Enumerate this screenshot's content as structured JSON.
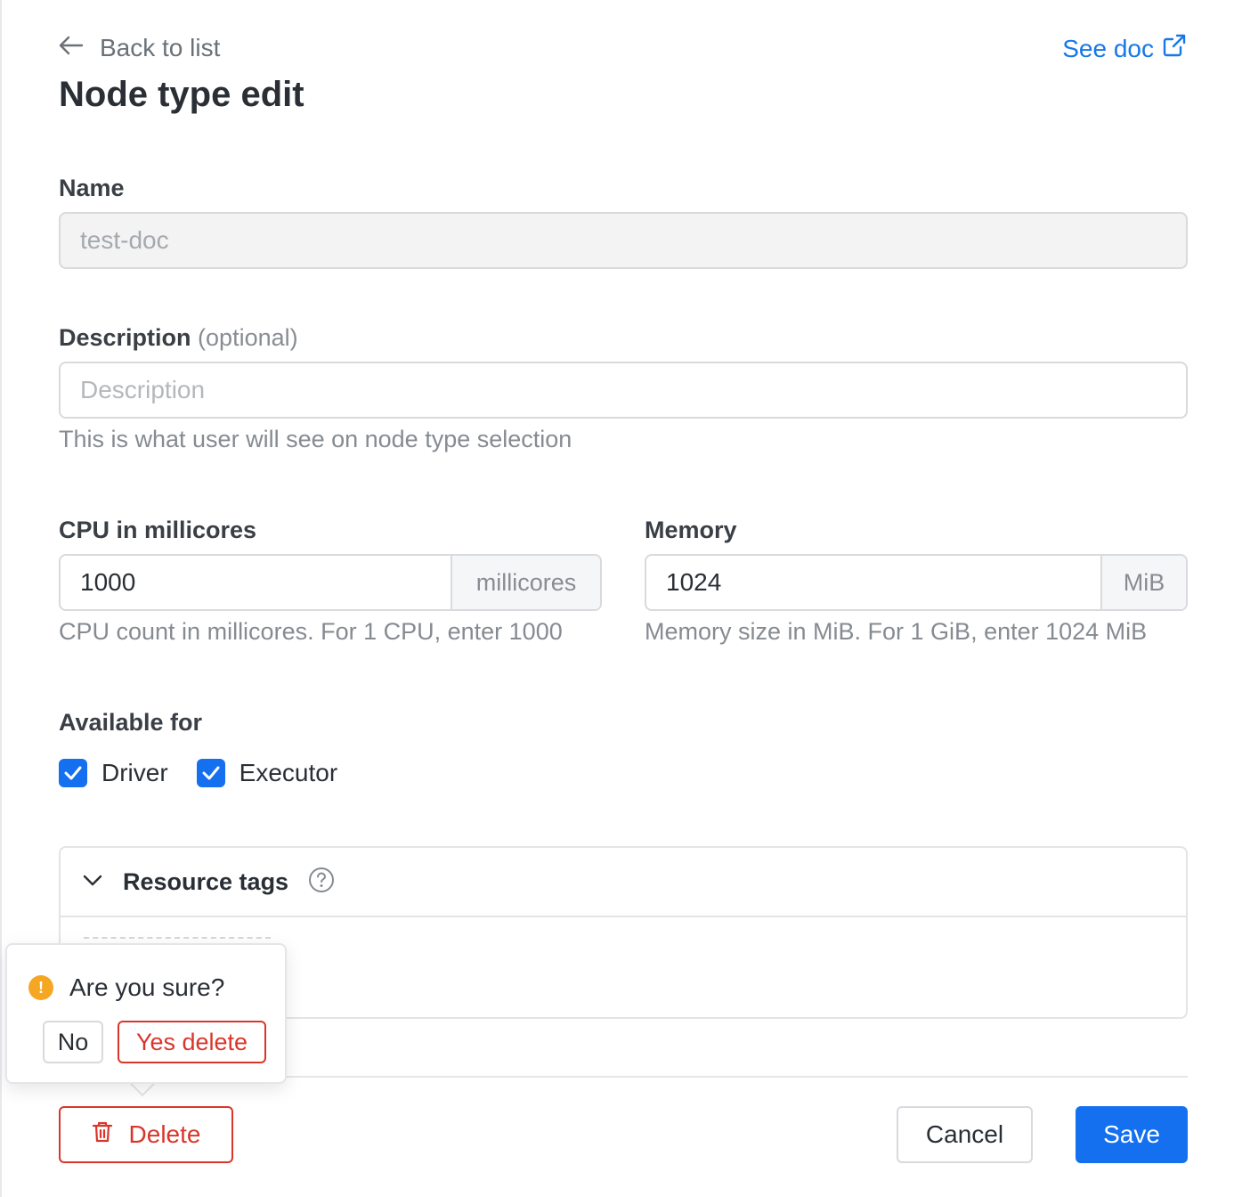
{
  "header": {
    "back_label": "Back to list",
    "see_doc_label": "See doc",
    "title": "Node type edit"
  },
  "form": {
    "name": {
      "label": "Name",
      "value": "test-doc"
    },
    "description": {
      "label": "Description",
      "optional": "(optional)",
      "placeholder": "Description",
      "help": "This is what user will see on node type selection"
    },
    "cpu": {
      "label": "CPU in millicores",
      "value": "1000",
      "unit": "millicores",
      "help": "CPU count in millicores. For 1 CPU, enter 1000"
    },
    "memory": {
      "label": "Memory",
      "value": "1024",
      "unit": "MiB",
      "help": "Memory size in MiB. For 1 GiB, enter 1024 MiB"
    },
    "available_for": {
      "label": "Available for",
      "options": [
        {
          "label": "Driver",
          "checked": true
        },
        {
          "label": "Executor",
          "checked": true
        }
      ]
    },
    "resource_tags": {
      "title": "Resource tags",
      "expanded": true
    }
  },
  "popconfirm": {
    "message": "Are you sure?",
    "no_label": "No",
    "yes_label": "Yes delete"
  },
  "footer": {
    "delete_label": "Delete",
    "cancel_label": "Cancel",
    "save_label": "Save"
  },
  "colors": {
    "primary": "#1570ef",
    "danger": "#d9362b",
    "warning": "#f5a623",
    "link": "#1777e8"
  }
}
